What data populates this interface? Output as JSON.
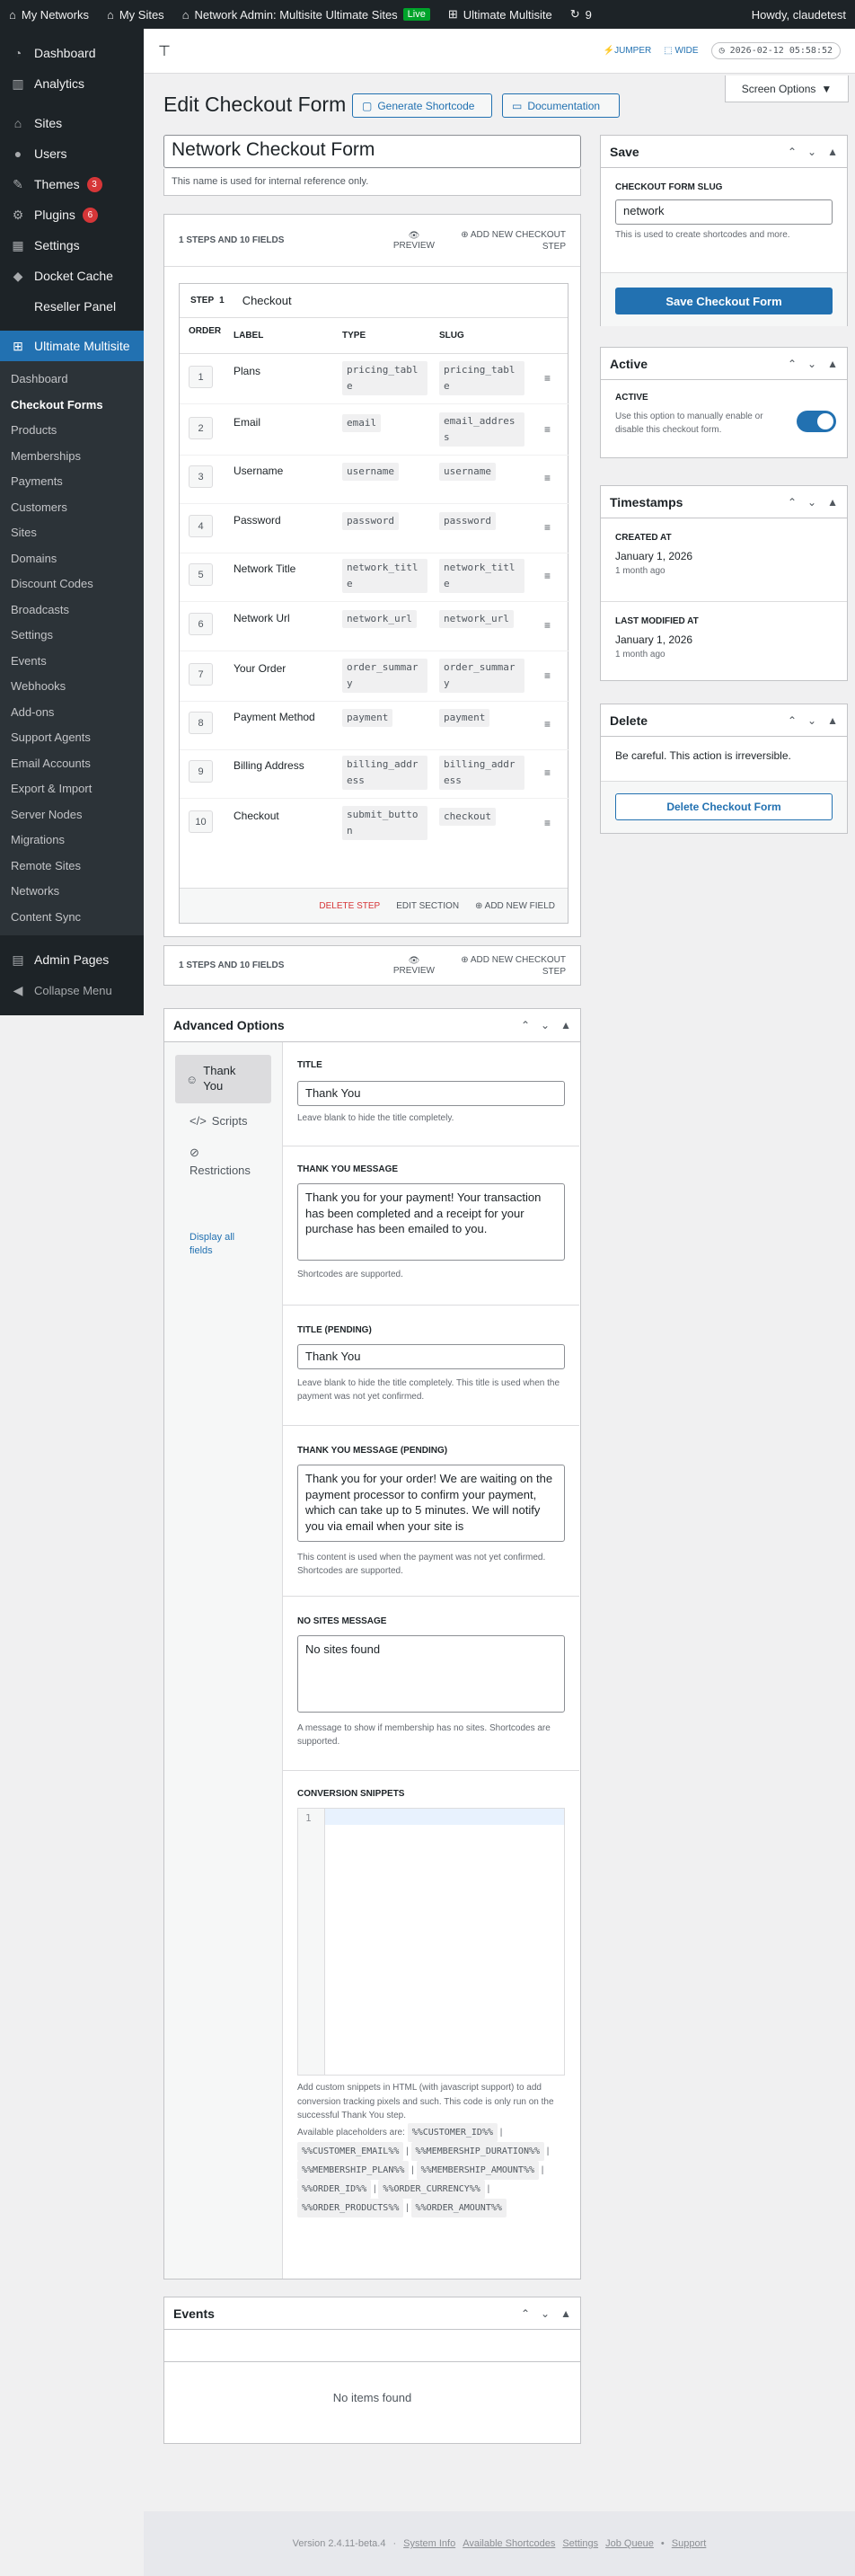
{
  "adminbar": {
    "my_networks": "My Networks",
    "my_sites": "My Sites",
    "network_admin": "Network Admin: Multisite Ultimate Sites",
    "live": "Live",
    "ultimate_multisite": "Ultimate Multisite",
    "updates": "9",
    "howdy": "Howdy, claudetest"
  },
  "sidebar": {
    "items": [
      {
        "label": "Dashboard",
        "icon": "dashboard-icon"
      },
      {
        "label": "Analytics",
        "icon": "analytics-icon"
      },
      {
        "label": "Sites",
        "icon": "sites-icon"
      },
      {
        "label": "Users",
        "icon": "users-icon"
      },
      {
        "label": "Themes",
        "icon": "themes-icon",
        "badge": "3"
      },
      {
        "label": "Plugins",
        "icon": "plugins-icon",
        "badge": "6"
      },
      {
        "label": "Settings",
        "icon": "settings-icon"
      },
      {
        "label": "Docket Cache",
        "icon": "docket-cache-icon"
      },
      {
        "label": "Reseller Panel",
        "icon": ""
      },
      {
        "label": "Ultimate Multisite",
        "icon": "ultimate-multisite-icon"
      }
    ],
    "submenu": [
      "Dashboard",
      "Checkout Forms",
      "Products",
      "Memberships",
      "Payments",
      "Customers",
      "Sites",
      "Domains",
      "Discount Codes",
      "Broadcasts",
      "Settings",
      "Events",
      "Webhooks",
      "Add-ons",
      "Support Agents",
      "Email Accounts",
      "Export & Import",
      "Server Nodes",
      "Migrations",
      "Remote Sites",
      "Networks",
      "Content Sync"
    ],
    "admin_pages": "Admin Pages",
    "collapse": "Collapse Menu"
  },
  "topstrip": {
    "jumper": "JUMPER",
    "wide": "WIDE",
    "datetime": "2026-02-12 05:58:52"
  },
  "screen_options": "Screen Options",
  "page": {
    "title": "Edit Checkout Form",
    "generate_shortcode": "Generate Shortcode",
    "documentation": "Documentation",
    "form_name": "Network Checkout Form",
    "form_name_help": "This name is used for internal reference only."
  },
  "steps_bar": {
    "summary": "1 STEPS AND 10 FIELDS",
    "preview": "PREVIEW",
    "add_step": "ADD NEW CHECKOUT STEP"
  },
  "step": {
    "label": "STEP",
    "number": "1",
    "name": "Checkout",
    "columns": [
      "ORDER",
      "LABEL",
      "TYPE",
      "SLUG"
    ],
    "rows": [
      {
        "order": "1",
        "label": "Plans",
        "type": "pricing_table",
        "slug": "pricing_table"
      },
      {
        "order": "2",
        "label": "Email",
        "type": "email",
        "slug": "email_address"
      },
      {
        "order": "3",
        "label": "Username",
        "type": "username",
        "slug": "username"
      },
      {
        "order": "4",
        "label": "Password",
        "type": "password",
        "slug": "password"
      },
      {
        "order": "5",
        "label": "Network Title",
        "type": "network_title",
        "slug": "network_title"
      },
      {
        "order": "6",
        "label": "Network Url",
        "type": "network_url",
        "slug": "network_url"
      },
      {
        "order": "7",
        "label": "Your Order",
        "type": "order_summary",
        "slug": "order_summary"
      },
      {
        "order": "8",
        "label": "Payment Method",
        "type": "payment",
        "slug": "payment"
      },
      {
        "order": "9",
        "label": "Billing Address",
        "type": "billing_address",
        "slug": "billing_address"
      },
      {
        "order": "10",
        "label": "Checkout",
        "type": "submit_button",
        "slug": "checkout"
      }
    ],
    "delete_step": "DELETE STEP",
    "edit_section": "EDIT SECTION",
    "add_field": "ADD NEW FIELD"
  },
  "advanced": {
    "title": "Advanced Options",
    "tabs": [
      "Thank You",
      "Scripts",
      "Restrictions"
    ],
    "display_all": "Display all fields",
    "title_label": "TITLE",
    "title_value": "Thank You",
    "title_help": "Leave blank to hide the title completely.",
    "msg_label": "THANK YOU MESSAGE",
    "msg_value": "Thank you for your payment! Your transaction has been completed and a receipt for your purchase has been emailed to you.",
    "msg_help": "Shortcodes are supported.",
    "pending_title_label": "TITLE (PENDING)",
    "pending_title_value": "Thank You",
    "pending_title_help": "Leave blank to hide the title completely. This title is used when the payment was not yet confirmed.",
    "pending_msg_label": "THANK YOU MESSAGE (PENDING)",
    "pending_msg_value": "Thank you for your order! We are waiting on the payment processor to confirm your payment, which can take up to 5 minutes. We will notify you via email when your site is",
    "pending_msg_help": "This content is used when the payment was not yet confirmed. Shortcodes are supported.",
    "nosites_label": "NO SITES MESSAGE",
    "nosites_value": "No sites found",
    "nosites_help": "A message to show if membership has no sites. Shortcodes are supported.",
    "snippets_label": "CONVERSION SNIPPETS",
    "snippets_line": "1",
    "snippets_help": "Add custom snippets in HTML (with javascript support) to add conversion tracking pixels and such. This code is only run on the successful Thank You step.",
    "placeholders_intro": "Available placeholders are:",
    "placeholders": [
      "%%CUSTOMER_ID%%",
      "%%CUSTOMER_EMAIL%%",
      "%%MEMBERSHIP_DURATION%%",
      "%%MEMBERSHIP_PLAN%%",
      "%%MEMBERSHIP_AMOUNT%%",
      "%%ORDER_ID%%",
      "%%ORDER_CURRENCY%%",
      "%%ORDER_PRODUCTS%%",
      "%%ORDER_AMOUNT%%"
    ]
  },
  "events": {
    "title": "Events",
    "empty": "No items found"
  },
  "save_box": {
    "title": "Save",
    "slug_label": "CHECKOUT FORM SLUG",
    "slug_value": "network",
    "slug_help": "This is used to create shortcodes and more.",
    "save_button": "Save Checkout Form"
  },
  "active_box": {
    "title": "Active",
    "label": "ACTIVE",
    "help": "Use this option to manually enable or disable this checkout form."
  },
  "timestamps_box": {
    "title": "Timestamps",
    "created_label": "CREATED AT",
    "created_value": "January 1, 2026",
    "created_ago": "1 month ago",
    "modified_label": "LAST MODIFIED AT",
    "modified_value": "January 1, 2026",
    "modified_ago": "1 month ago"
  },
  "delete_box": {
    "title": "Delete",
    "warning": "Be careful. This action is irreversible.",
    "button": "Delete Checkout Form"
  },
  "footer": {
    "version": "Version 2.4.11-beta.4",
    "links": [
      "System Info",
      "Available Shortcodes",
      "Settings",
      "Job Queue",
      "Support"
    ]
  },
  "colors": {
    "accent": "#2271b1",
    "sidebar": "#1d2327",
    "danger": "#d63638",
    "live": "#00a32a"
  }
}
